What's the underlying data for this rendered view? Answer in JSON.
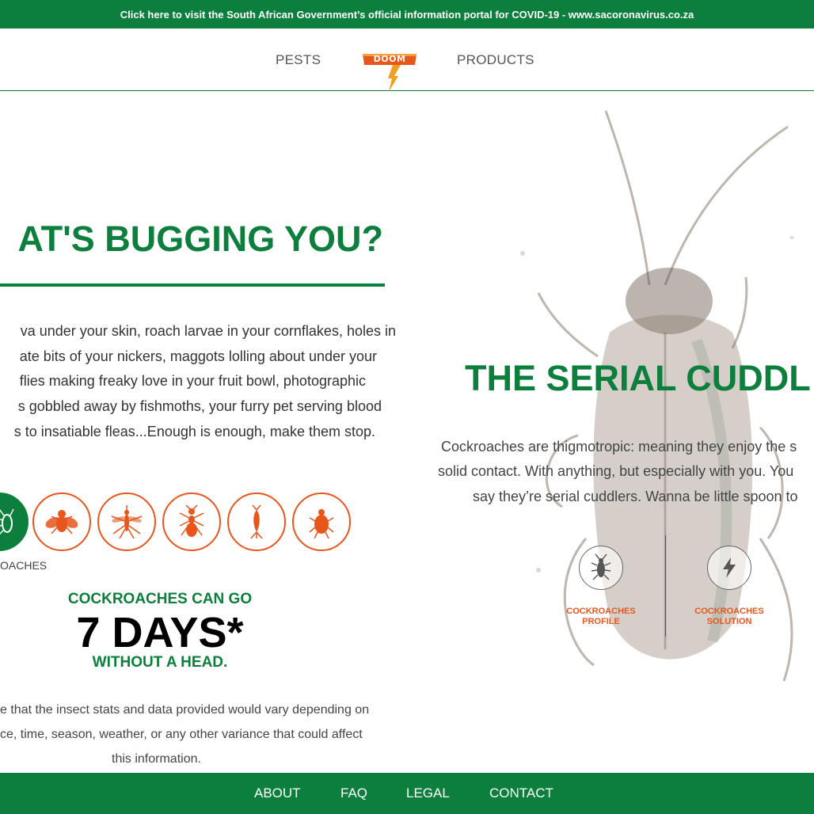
{
  "banner": {
    "text": "Click here to visit the South African Government’s official information portal for COVID-19 - www.sacoronavirus.co.za"
  },
  "nav": {
    "pests": "PESTS",
    "logo_text": "DOOM",
    "products": "PRODUCTS"
  },
  "main": {
    "heading": "AT'S BUGGING YOU?",
    "intro_lines": [
      "va under your skin, roach larvae in your cornflakes, holes in",
      "ate bits of your nickers, maggots lolling about under your",
      "flies making freaky love in your fruit bowl, photographic",
      "s gobbled away by fishmoths, your furry pet serving blood",
      "s to insatiable fleas...Enough is enough, make them stop."
    ],
    "selected_pest_label": "OACHES",
    "stat_line1": "COCKROACHES CAN GO",
    "stat_line2": "7 DAYS*",
    "stat_line3": "WITHOUT A HEAD.",
    "disclaimer_lines": [
      "e that the insect stats and data provided would vary depending on",
      "ce, time, season, weather, or any other variance that could affect",
      "this information."
    ]
  },
  "feature": {
    "title": "THE SERIAL CUDDL",
    "text_lines": [
      "Cockroaches are thigmotropic: meaning they enjoy the s",
      "solid contact. With anything, but especially with you. You",
      "say they’re serial cuddlers. Wanna be little spoon to"
    ],
    "profile_line1": "COCKROACHES",
    "profile_line2": "PROFILE",
    "solution_line1": "COCKROACHES",
    "solution_line2": "SOLUTION"
  },
  "footer": {
    "about": "ABOUT",
    "faq": "FAQ",
    "legal": "LEGAL",
    "contact": "CONTACT"
  },
  "colors": {
    "brand_green": "#0b7f3b",
    "accent_orange": "#e8561c"
  },
  "icons": [
    "cockroach-icon",
    "fly-icon",
    "mosquito-icon",
    "ant-icon",
    "fishmoth-icon",
    "flea-icon",
    "lightning-icon"
  ]
}
